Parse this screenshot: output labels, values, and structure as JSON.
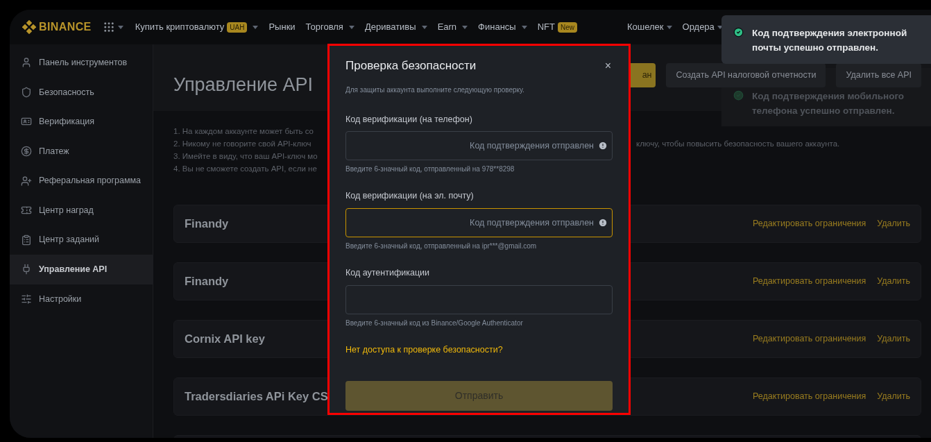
{
  "nav": {
    "logo": "BINANCE",
    "items": [
      {
        "label": "Купить криптовалюту",
        "badge": "UAH",
        "caret": true
      },
      {
        "label": "Рынки",
        "caret": false
      },
      {
        "label": "Торговля",
        "caret": true
      },
      {
        "label": "Деривативы",
        "caret": true
      },
      {
        "label": "Earn",
        "caret": true
      },
      {
        "label": "Финансы",
        "caret": true
      },
      {
        "label": "NFT",
        "badge": "New",
        "caret": false
      }
    ],
    "right_items": [
      {
        "label": "Кошелек",
        "caret": true
      },
      {
        "label": "Ордера",
        "caret": true
      }
    ]
  },
  "sidebar": {
    "items": [
      {
        "label": "Панель инструментов",
        "selected": false
      },
      {
        "label": "Безопасность",
        "selected": false
      },
      {
        "label": "Верификация",
        "selected": false
      },
      {
        "label": "Платеж",
        "selected": false
      },
      {
        "label": "Реферальная программа",
        "selected": false
      },
      {
        "label": "Центр наград",
        "selected": false
      },
      {
        "label": "Центр заданий",
        "selected": false
      },
      {
        "label": "Управление API",
        "selected": true
      },
      {
        "label": "Настройки",
        "selected": false
      }
    ]
  },
  "page": {
    "title": "Управление API",
    "buttons": [
      {
        "label": "ан",
        "kind": "primary"
      },
      {
        "label": "Создать API налоговой отчетности",
        "kind": "secondary"
      },
      {
        "label": "Удалить все API",
        "kind": "secondary"
      }
    ],
    "notes": [
      {
        "left": "1. На каждом аккаунте может быть со"
      },
      {
        "left": "2. Никому не говорите свой API-ключ",
        "right": "ключу, чтобы повысить безопасность вашего аккаунта."
      },
      {
        "left": "3. Имейте в виду, что ваш API-ключ мо"
      },
      {
        "left": "4. Вы не сможете создать API, если не"
      }
    ],
    "api_keys": [
      {
        "name": "Finandy",
        "edit": "Редактировать ограничения",
        "delete": "Удалить"
      },
      {
        "name": "Finandy",
        "edit": "Редактировать ограничения",
        "delete": "Удалить"
      },
      {
        "name": "Cornix API key",
        "edit": "Редактировать ограничения",
        "delete": "Удалить"
      },
      {
        "name": "Tradersdiaries APi Key CS",
        "edit": "Редактировать ограничения",
        "delete": "Удалить"
      }
    ]
  },
  "modal": {
    "title": "Проверка безопасности",
    "close": "×",
    "subtitle": "Для защиты аккаунта выполните следующую проверку.",
    "fields": [
      {
        "label": "Код верификации (на телефон)",
        "status": "Код подтверждения отправлен",
        "hint": "Введите 6-значный код, отправленный на 978**8298",
        "focused": false
      },
      {
        "label": "Код верификации (на эл. почту)",
        "status": "Код подтверждения отправлен",
        "hint": "Введите 6-значный код, отправленный на ipr***@gmail.com",
        "focused": true
      },
      {
        "label": "Код аутентификации",
        "hint": "Введите 6-значный код из Binance/Google Authenticator",
        "focused": false
      }
    ],
    "link": "Нет доступа к проверке безопасности?",
    "submit": {
      "label": "Отправить",
      "disabled": true
    }
  },
  "toasts": [
    {
      "text": "Код подтверждения электронной почты успешно отправлен.",
      "faded": false
    },
    {
      "text": "Код подтверждения мобильного телефона успешно отправлен.",
      "faded": true
    }
  ]
}
